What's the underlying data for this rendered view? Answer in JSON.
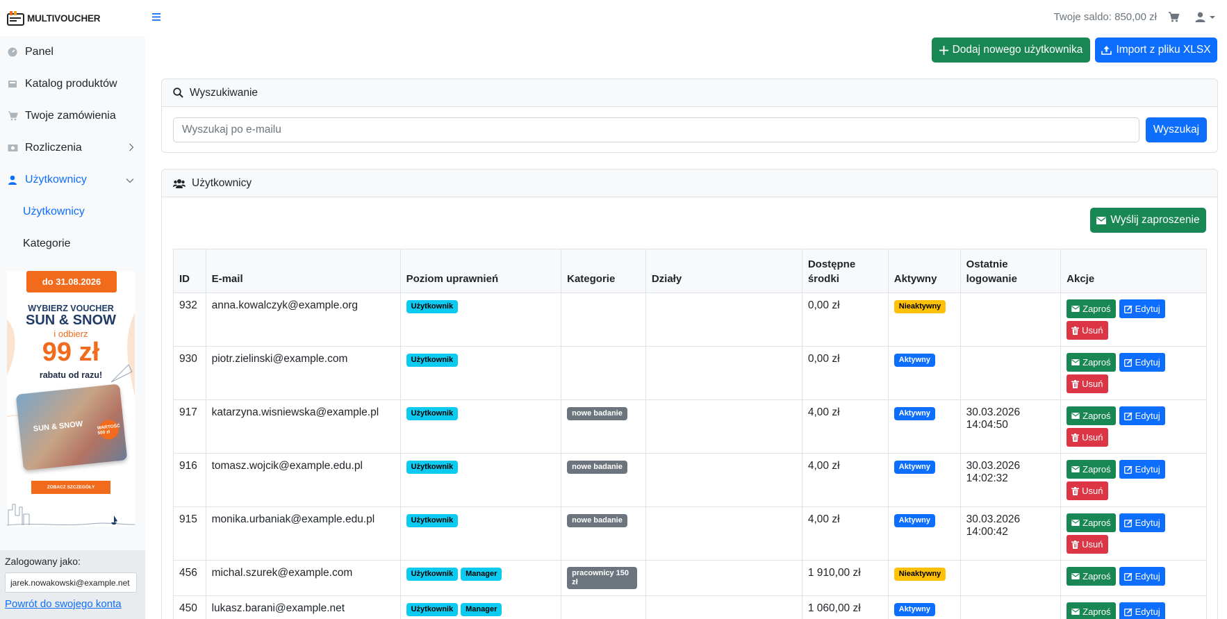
{
  "app": {
    "logo_text": "MULTIVOUCHER"
  },
  "sidebar": {
    "items": [
      {
        "label": "Panel",
        "icon": "speedometer-icon"
      },
      {
        "label": "Katalog produktów",
        "icon": "catalog-icon"
      },
      {
        "label": "Twoje zamówienia",
        "icon": "cart-icon"
      },
      {
        "label": "Rozliczenia",
        "icon": "billing-icon"
      },
      {
        "label": "Użytkownicy",
        "icon": "person-icon"
      }
    ],
    "subitems": [
      {
        "label": "Użytkownicy"
      },
      {
        "label": "Kategorie"
      }
    ],
    "promo": {
      "badge": "do 31.08.2026",
      "line1": "WYBIERZ VOUCHER",
      "line2": "SUN & SNOW",
      "line3": "i odbierz",
      "line4": "99 zł",
      "line5": "rabatu od razu!",
      "card_text": "SUN & SNOW",
      "card_badge": "WARTOŚĆ 500 zł",
      "cta": "ZOBACZ SZCZEGÓŁY"
    },
    "logged": {
      "label": "Zalogowany jako:",
      "email": "jarek.nowakowski@example.net",
      "back_link": "Powrót do swojego konta"
    }
  },
  "topbar": {
    "saldo": "Twoje saldo: 850,00 zł"
  },
  "toolbar": {
    "add_user": "Dodaj nowego użytkownika",
    "import": "Import z pliku XLSX"
  },
  "search": {
    "title": "Wyszukiwanie",
    "placeholder": "Wyszukaj po e-mailu",
    "button": "Wyszukaj"
  },
  "users": {
    "title": "Użytkownicy",
    "invite_button": "Wyślij zaproszenie",
    "columns": [
      "ID",
      "E-mail",
      "Poziom uprawnień",
      "Kategorie",
      "Działy",
      "Dostępne\nśrodki",
      "Aktywny",
      "Ostatnie\nlogowanie",
      "Akcje"
    ],
    "action_labels": {
      "invite": "Zaproś",
      "edit": "Edytuj",
      "delete": "Usuń"
    },
    "rows": [
      {
        "id": "932",
        "email": "anna.kowalczyk@example.org",
        "roles": [
          "Użytkownik"
        ],
        "categories": [],
        "departments": "",
        "funds": "0,00 zł",
        "active": "Nieaktywny",
        "last_login": "",
        "deletable": true
      },
      {
        "id": "930",
        "email": "piotr.zielinski@example.com",
        "roles": [
          "Użytkownik"
        ],
        "categories": [],
        "departments": "",
        "funds": "0,00 zł",
        "active": "Aktywny",
        "last_login": "",
        "deletable": true
      },
      {
        "id": "917",
        "email": "katarzyna.wisniewska@example.pl",
        "roles": [
          "Użytkownik"
        ],
        "categories": [
          "nowe badanie"
        ],
        "departments": "",
        "funds": "4,00 zł",
        "active": "Aktywny",
        "last_login": "30.03.2026 14:04:50",
        "deletable": true
      },
      {
        "id": "916",
        "email": "tomasz.wojcik@example.edu.pl",
        "roles": [
          "Użytkownik"
        ],
        "categories": [
          "nowe badanie"
        ],
        "departments": "",
        "funds": "4,00 zł",
        "active": "Aktywny",
        "last_login": "30.03.2026 14:02:32",
        "deletable": true
      },
      {
        "id": "915",
        "email": "monika.urbaniak@example.edu.pl",
        "roles": [
          "Użytkownik"
        ],
        "categories": [
          "nowe badanie"
        ],
        "departments": "",
        "funds": "4,00 zł",
        "active": "Aktywny",
        "last_login": "30.03.2026 14:00:42",
        "deletable": true
      },
      {
        "id": "456",
        "email": "michal.szurek@example.com",
        "roles": [
          "Użytkownik",
          "Manager"
        ],
        "categories": [
          "pracownicy 150 zł"
        ],
        "departments": "",
        "funds": "1 910,00 zł",
        "active": "Nieaktywny",
        "last_login": "",
        "deletable": false
      },
      {
        "id": "450",
        "email": "lukasz.barani@example.net",
        "roles": [
          "Użytkownik",
          "Manager"
        ],
        "categories": [],
        "departments": "",
        "funds": "1 060,00 zł",
        "active": "Aktywny",
        "last_login": "",
        "deletable": false
      }
    ]
  },
  "colors": {
    "primary": "#0d6efd",
    "success": "#198754",
    "danger": "#dc3545",
    "warning": "#ffc107",
    "info": "#0dcaf0",
    "secondary": "#6c757d",
    "promo_orange": "#f26a1b"
  }
}
